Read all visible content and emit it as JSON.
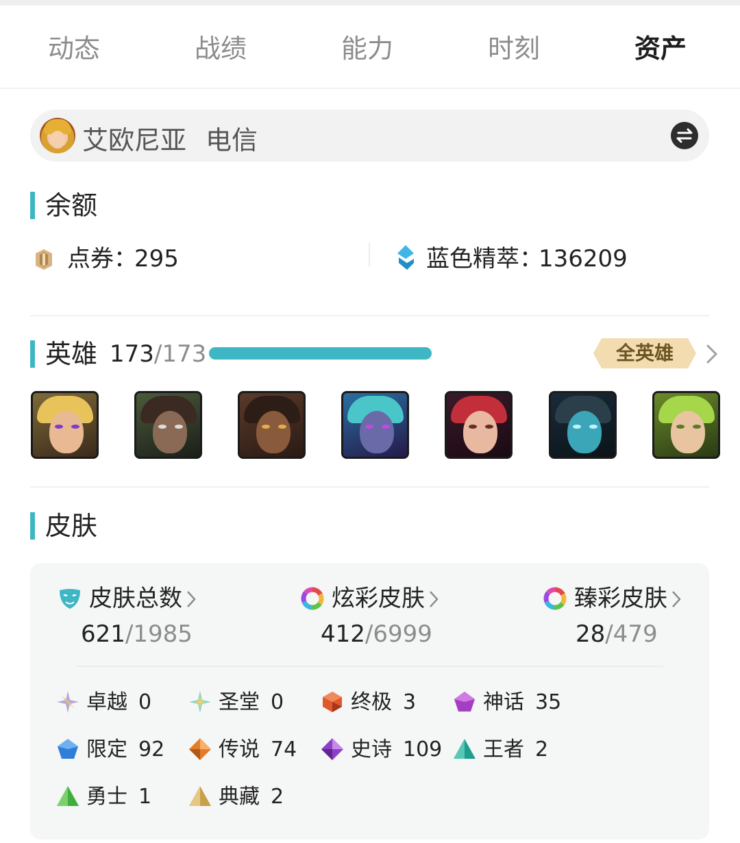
{
  "tabs": [
    {
      "label": "动态",
      "active": false
    },
    {
      "label": "战绩",
      "active": false
    },
    {
      "label": "能力",
      "active": false
    },
    {
      "label": "时刻",
      "active": false
    },
    {
      "label": "资产",
      "active": true
    }
  ],
  "account": {
    "name": "艾欧尼亚",
    "server": "电信",
    "avatar_icon": "summoner-avatar",
    "switch_icon": "swap-arrows-icon"
  },
  "balance": {
    "title": "余额",
    "points_label": "点券：",
    "points_value": "295",
    "essence_label": "蓝色精萃：",
    "essence_value": "136209"
  },
  "heroes": {
    "title": "英雄",
    "owned": "173",
    "total": "/173",
    "progress": 1.0,
    "all_button": "全英雄",
    "portraits": [
      {
        "icon": "champion-ezreal-portrait"
      },
      {
        "icon": "champion-samira-portrait"
      },
      {
        "icon": "champion-senna-portrait"
      },
      {
        "icon": "champion-vex-portrait"
      },
      {
        "icon": "champion-xayah-portrait"
      },
      {
        "icon": "champion-kalista-portrait"
      },
      {
        "icon": "champion-zeri-portrait"
      }
    ]
  },
  "skins": {
    "title": "皮肤",
    "stats": [
      {
        "label": "皮肤总数",
        "owned": "621",
        "total": "/1985",
        "icon": "mask-icon"
      },
      {
        "label": "炫彩皮肤",
        "owned": "412",
        "total": "/6999",
        "icon": "chroma-ring-icon"
      },
      {
        "label": "臻彩皮肤",
        "owned": "28",
        "total": "/479",
        "icon": "prestige-ring-icon"
      }
    ],
    "tiers": [
      {
        "name": "卓越",
        "value": "0",
        "icon": "transcendent-star-icon",
        "color": "#b9a7d8"
      },
      {
        "name": "圣堂",
        "value": "0",
        "icon": "exalted-star-icon",
        "color": "#7fd6c7"
      },
      {
        "name": "终极",
        "value": "3",
        "icon": "ultimate-gem-icon",
        "color": "#e0582d"
      },
      {
        "name": "神话",
        "value": "35",
        "icon": "mythic-gem-icon",
        "color": "#a53fc2"
      },
      {
        "name": "限定",
        "value": "92",
        "icon": "limited-gem-icon",
        "color": "#2f7ed8"
      },
      {
        "name": "传说",
        "value": "74",
        "icon": "legendary-gem-icon",
        "color": "#e57d28"
      },
      {
        "name": "史诗",
        "value": "109",
        "icon": "epic-gem-icon",
        "color": "#8e3fc8"
      },
      {
        "name": "王者",
        "value": "2",
        "icon": "champion-gem-icon",
        "color": "#1f9e8c"
      },
      {
        "name": "勇士",
        "value": "1",
        "icon": "warrior-gem-icon",
        "color": "#3fae3a"
      },
      {
        "name": "典藏",
        "value": "2",
        "icon": "collectible-gem-icon",
        "color": "#c9a04a"
      }
    ]
  }
}
